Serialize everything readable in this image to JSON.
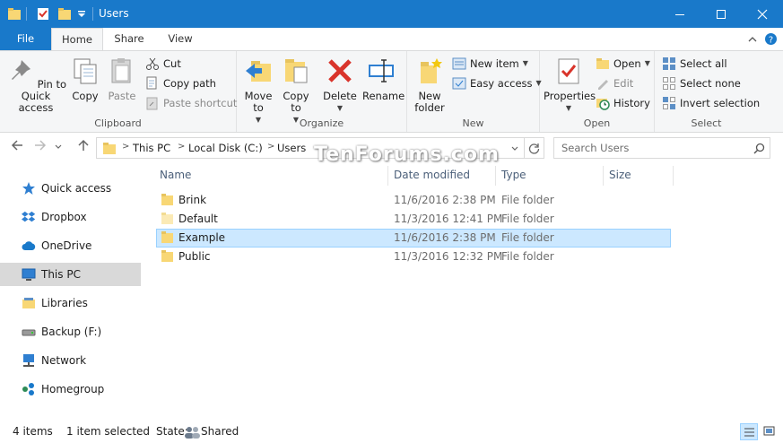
{
  "window": {
    "title": "Users"
  },
  "tabs": {
    "file": "File",
    "home": "Home",
    "share": "Share",
    "view": "View"
  },
  "ribbon": {
    "clipboard": {
      "label": "Clipboard",
      "pin": "Pin to Quick access",
      "copy": "Copy",
      "paste": "Paste",
      "cut": "Cut",
      "copy_path": "Copy path",
      "paste_shortcut": "Paste shortcut"
    },
    "organize": {
      "label": "Organize",
      "move_to": "Move to",
      "copy_to": "Copy to",
      "delete": "Delete",
      "rename": "Rename"
    },
    "new": {
      "label": "New",
      "new_folder": "New folder",
      "new_item": "New item",
      "easy_access": "Easy access"
    },
    "open": {
      "label": "Open",
      "properties": "Properties",
      "open": "Open",
      "edit": "Edit",
      "history": "History"
    },
    "select": {
      "label": "Select",
      "select_all": "Select all",
      "select_none": "Select none",
      "invert": "Invert selection"
    }
  },
  "address": {
    "crumbs": [
      "This PC",
      "Local Disk (C:)",
      "Users"
    ]
  },
  "search": {
    "placeholder": "Search Users"
  },
  "watermark": "TenForums.com",
  "nav": [
    {
      "label": "Quick access",
      "icon": "star-icon"
    },
    {
      "label": "Dropbox",
      "icon": "dropbox-icon"
    },
    {
      "label": "OneDrive",
      "icon": "cloud-icon"
    },
    {
      "label": "This PC",
      "icon": "computer-icon"
    },
    {
      "label": "Libraries",
      "icon": "library-icon"
    },
    {
      "label": "Backup (F:)",
      "icon": "drive-icon"
    },
    {
      "label": "Network",
      "icon": "network-icon"
    },
    {
      "label": "Homegroup",
      "icon": "homegroup-icon"
    }
  ],
  "columns": {
    "name": "Name",
    "date": "Date modified",
    "type": "Type",
    "size": "Size"
  },
  "files": [
    {
      "name": "Brink",
      "date": "11/6/2016 2:38 PM",
      "type": "File folder"
    },
    {
      "name": "Default",
      "date": "11/3/2016 12:41 PM",
      "type": "File folder"
    },
    {
      "name": "Example",
      "date": "11/6/2016 2:38 PM",
      "type": "File folder"
    },
    {
      "name": "Public",
      "date": "11/3/2016 12:32 PM",
      "type": "File folder"
    }
  ],
  "status": {
    "count": "4 items",
    "selected": "1 item selected",
    "state_label": "State:",
    "state_value": "Shared"
  },
  "colors": {
    "accent": "#1979ca",
    "selection": "#cce8ff",
    "folder": "#f8d775"
  }
}
